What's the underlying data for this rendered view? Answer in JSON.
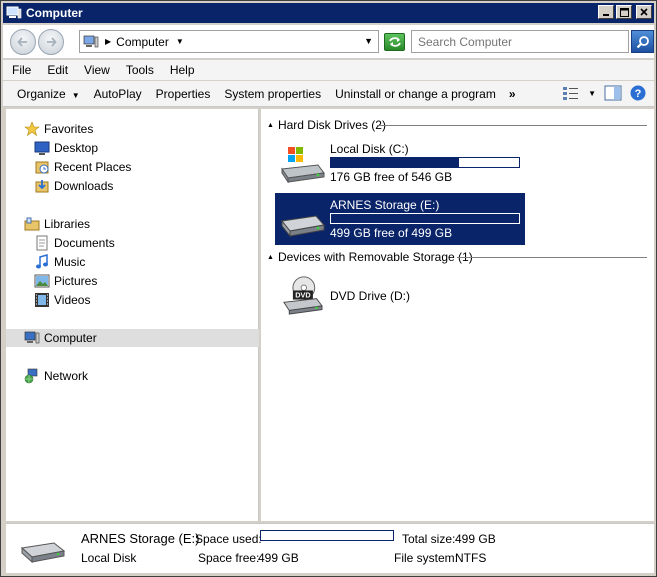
{
  "window": {
    "title": "Computer"
  },
  "address": {
    "location": "Computer"
  },
  "search": {
    "placeholder": "Search Computer"
  },
  "menu": [
    "File",
    "Edit",
    "View",
    "Tools",
    "Help"
  ],
  "toolbar": {
    "organize": "Organize",
    "autoplay": "AutoPlay",
    "properties": "Properties",
    "system_properties": "System properties",
    "uninstall": "Uninstall or change a program",
    "overflow": "»"
  },
  "nav": {
    "favorites": "Favorites",
    "desktop": "Desktop",
    "recent_places": "Recent Places",
    "downloads": "Downloads",
    "libraries": "Libraries",
    "documents": "Documents",
    "music": "Music",
    "pictures": "Pictures",
    "videos": "Videos",
    "computer": "Computer",
    "network": "Network"
  },
  "groups": {
    "hdd": "Hard Disk Drives (2)",
    "removable": "Devices with Removable Storage (1)"
  },
  "drives": [
    {
      "name": "Local Disk (C:)",
      "free": "176 GB free of 546 GB",
      "used_fraction": 0.68
    },
    {
      "name": "ARNES Storage (E:)",
      "free": "499 GB free of 499 GB",
      "used_fraction": 0.0
    },
    {
      "name": "DVD Drive (D:)",
      "dvd_label": "DVD"
    }
  ],
  "details": {
    "name": "ARNES Storage (E:)",
    "type": "Local Disk",
    "space_used_label": "Space used:",
    "space_free_label": "Space free:",
    "space_free": "499 GB",
    "total_size_label": "Total size:",
    "total_size": "499 GB",
    "file_system_label": "File system:",
    "file_system": "NTFS"
  },
  "colors": {
    "selection": "#0a246a",
    "titlebar": "#0a246a"
  }
}
